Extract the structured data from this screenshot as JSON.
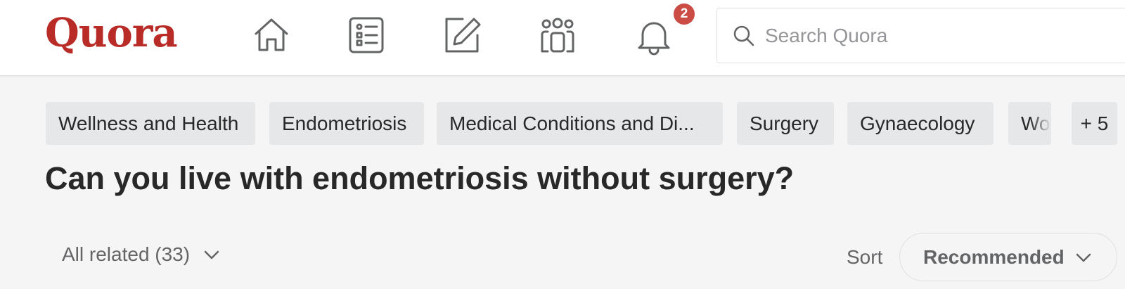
{
  "header": {
    "logo": "Quora",
    "nav": {
      "home_icon": "home-icon",
      "following_icon": "list-icon",
      "answer_icon": "edit-icon",
      "spaces_icon": "people-icon",
      "notifications_icon": "bell-icon"
    },
    "notification_count": "2",
    "search": {
      "placeholder": "Search Quora",
      "value": ""
    }
  },
  "topics": {
    "chips": [
      "Wellness and Health",
      "Endometriosis",
      "Medical Conditions and Di...",
      "Surgery",
      "Gynaecology",
      "Wo"
    ],
    "more": "+ 5"
  },
  "question": {
    "title": "Can you live with endometriosis without surgery?"
  },
  "filters": {
    "related": "All related (33)",
    "sort_label": "Sort",
    "sort_value": "Recommended"
  },
  "colors": {
    "brand": "#b92b27",
    "badge": "#cb4b45",
    "chip_bg": "#e6e7e8",
    "page_bg": "#f5f5f5"
  }
}
